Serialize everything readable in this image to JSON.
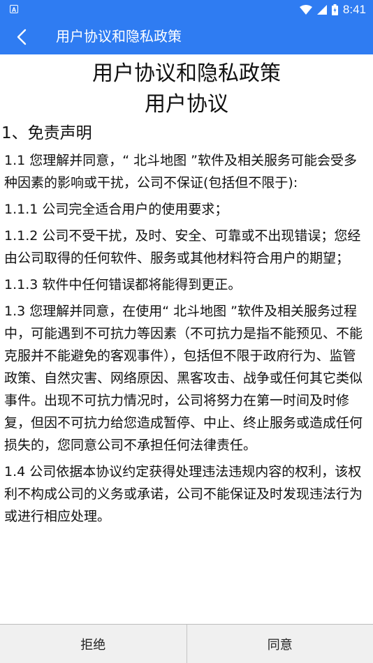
{
  "status_bar": {
    "time": "8:41",
    "left_icon": "A",
    "icons": [
      "wifi-icon",
      "signal-icon",
      "battery-icon"
    ]
  },
  "app_bar": {
    "title": "用户协议和隐私政策",
    "back_icon": "chevron-left-icon"
  },
  "document": {
    "title": "用户协议和隐私政策",
    "subtitle": "用户协议",
    "section_heading": "1、免责声明",
    "paragraphs": [
      "1.1 您理解并同意，“ 北斗地图 ”软件及相关服务可能会受多种因素的影响或干扰，公司不保证(包括但不限于):",
      "1.1.1 公司完全适合用户的使用要求；",
      "1.1.2 公司不受干扰，及时、安全、可靠或不出现错误；您经由公司取得的任何软件、服务或其他材料符合用户的期望；",
      "1.1.3 软件中任何错误都将能得到更正。",
      "1.3 您理解并同意，在使用“ 北斗地图 ”软件及相关服务过程中，可能遇到不可抗力等因素（不可抗力是指不能预见、不能克服并不能避免的客观事件），包括但不限于政府行为、监管政策、自然灾害、网络原因、黑客攻击、战争或任何其它类似事件。出现不可抗力情况时，公司将努力在第一时间及时修复，但因不可抗力给您造成暂停、中止、终止服务或造成任何损失的，您同意公司不承担任何法律责任。",
      "1.4 公司依据本协议约定获得处理违法违规内容的权利，该权利不构成公司的义务或承诺，公司不能保证及时发现违法行为或进行相应处理。"
    ]
  },
  "buttons": {
    "reject": "拒绝",
    "agree": "同意"
  },
  "colors": {
    "primary": "#2f7cf2",
    "bottom_bar": "#f0f0f0",
    "text": "#111111"
  }
}
